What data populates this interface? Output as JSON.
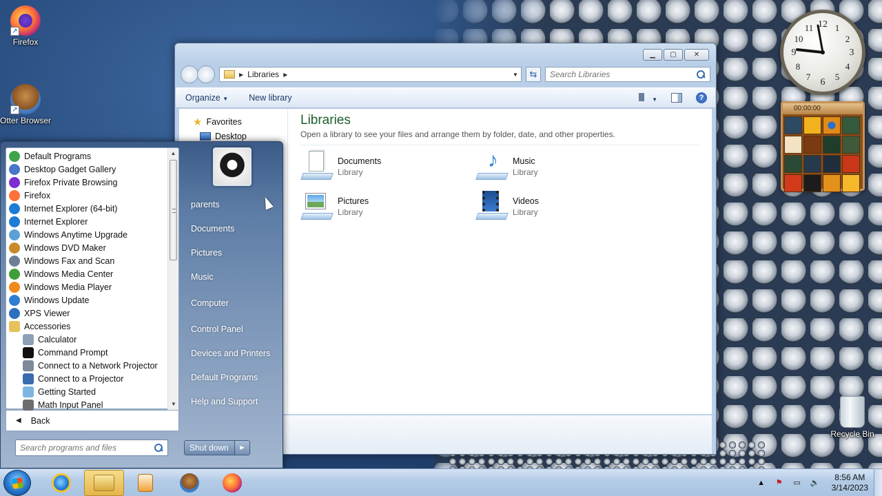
{
  "desktop": {
    "icons": [
      {
        "label": "Firefox"
      },
      {
        "label": "Otter Browser"
      },
      {
        "label": "Recycle Bin"
      }
    ]
  },
  "gadgets": {
    "clock": {
      "numbers": [
        "12",
        "1",
        "2",
        "3",
        "4",
        "5",
        "6",
        "7",
        "8",
        "9",
        "10",
        "11"
      ]
    },
    "puzzle": {
      "timer": "00:00:00"
    }
  },
  "explorer": {
    "breadcrumb": [
      "Libraries"
    ],
    "search_placeholder": "Search Libraries",
    "toolbar": {
      "organize": "Organize",
      "new_library": "New library",
      "help": "?"
    },
    "nav_pane": [
      {
        "label": "Favorites"
      },
      {
        "label": "Desktop"
      }
    ],
    "title": "Libraries",
    "description": "Open a library to see your files and arrange them by folder, date, and other properties.",
    "libraries": [
      {
        "name": "Documents",
        "sub": "Library"
      },
      {
        "name": "Music",
        "sub": "Library"
      },
      {
        "name": "Pictures",
        "sub": "Library"
      },
      {
        "name": "Videos",
        "sub": "Library"
      }
    ]
  },
  "start_menu": {
    "programs": [
      {
        "label": "Default Programs",
        "color": "#3fa34d"
      },
      {
        "label": "Desktop Gadget Gallery",
        "color": "#4a77c9"
      },
      {
        "label": "Firefox Private Browsing",
        "color": "#7b2fd1"
      },
      {
        "label": "Firefox",
        "color": "#ff7139"
      },
      {
        "label": "Internet Explorer (64-bit)",
        "color": "#1e7bd6"
      },
      {
        "label": "Internet Explorer",
        "color": "#1e7bd6"
      },
      {
        "label": "Windows Anytime Upgrade",
        "color": "#5aa0d8"
      },
      {
        "label": "Windows DVD Maker",
        "color": "#c98a2a"
      },
      {
        "label": "Windows Fax and Scan",
        "color": "#6c7f95"
      },
      {
        "label": "Windows Media Center",
        "color": "#3e9e3a"
      },
      {
        "label": "Windows Media Player",
        "color": "#f08a1c"
      },
      {
        "label": "Windows Update",
        "color": "#2d7dd2"
      },
      {
        "label": "XPS Viewer",
        "color": "#2f6fc0"
      },
      {
        "label": "Accessories",
        "color": "#e7c25c"
      },
      {
        "label": "Calculator",
        "color": "#8ea0b4",
        "indent": true
      },
      {
        "label": "Command Prompt",
        "color": "#111111",
        "indent": true
      },
      {
        "label": "Connect to a Network Projector",
        "color": "#7d8a99",
        "indent": true
      },
      {
        "label": "Connect to a Projector",
        "color": "#3a6ab0",
        "indent": true
      },
      {
        "label": "Getting Started",
        "color": "#7db5e0",
        "indent": true
      },
      {
        "label": "Math Input Panel",
        "color": "#6d6d6d",
        "indent": true
      }
    ],
    "back": "Back",
    "search_placeholder": "Search programs and files",
    "right_items": [
      "parents",
      "Documents",
      "Pictures",
      "Music",
      "Computer",
      "Control Panel",
      "Devices and Printers",
      "Default Programs",
      "Help and Support"
    ],
    "shutdown": "Shut down"
  },
  "taskbar": {
    "time": "8:56 AM",
    "date": "3/14/2023"
  }
}
